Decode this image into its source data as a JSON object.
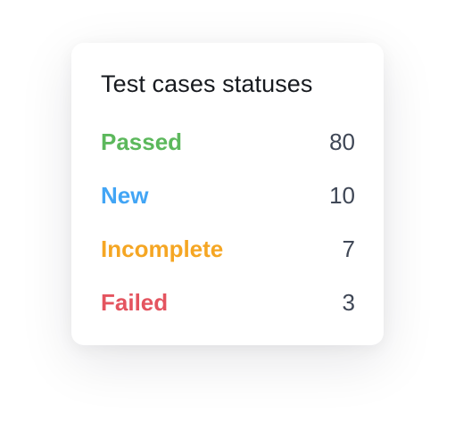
{
  "card": {
    "title": "Test cases statuses"
  },
  "statuses": [
    {
      "label": "Passed",
      "count": "80",
      "color": "#5cb85c"
    },
    {
      "label": "New",
      "count": "10",
      "color": "#42a5f5"
    },
    {
      "label": "Incomplete",
      "count": "7",
      "color": "#f5a623"
    },
    {
      "label": "Failed",
      "count": "3",
      "color": "#e4545f"
    }
  ]
}
